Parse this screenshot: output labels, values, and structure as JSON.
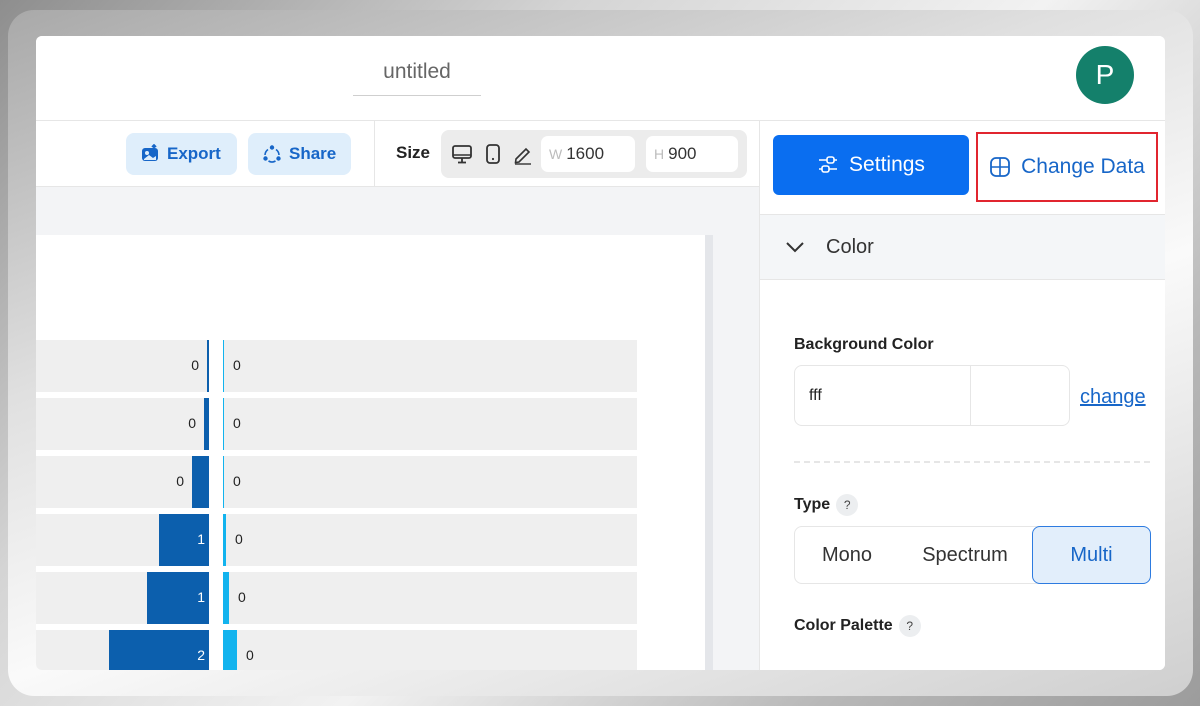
{
  "header": {
    "doc_title": "untitled",
    "avatar_initial": "P"
  },
  "toolbar": {
    "export_label": "Export",
    "share_label": "Share",
    "size_label": "Size",
    "width_prefix": "W",
    "width_value": "1600",
    "height_prefix": "H",
    "height_value": "900",
    "icons": [
      "desktop-icon",
      "mobile-icon",
      "pencil-icon"
    ]
  },
  "panel": {
    "settings_label": "Settings",
    "change_data_label": "Change Data",
    "color_section_label": "Color",
    "background_color_label": "Background Color",
    "background_color_value": "fff",
    "change_link_label": "change",
    "type_label": "Type",
    "type_help": "?",
    "type_options": [
      "Mono",
      "Spectrum",
      "Multi"
    ],
    "type_selected": "Multi",
    "palette_label": "Color Palette",
    "palette_help": "?"
  },
  "colors": {
    "primary": "#0a6ef0",
    "bar_left": "#0c5fad",
    "bar_right": "#12b3ee",
    "avatar": "#14806b",
    "highlight_border": "#e1252f"
  },
  "chart_data": {
    "type": "bar",
    "series": [
      {
        "values": [
          0,
          0,
          0,
          1,
          1,
          2
        ]
      },
      {
        "values": [
          0,
          0,
          0,
          0,
          0,
          0
        ]
      }
    ]
  }
}
